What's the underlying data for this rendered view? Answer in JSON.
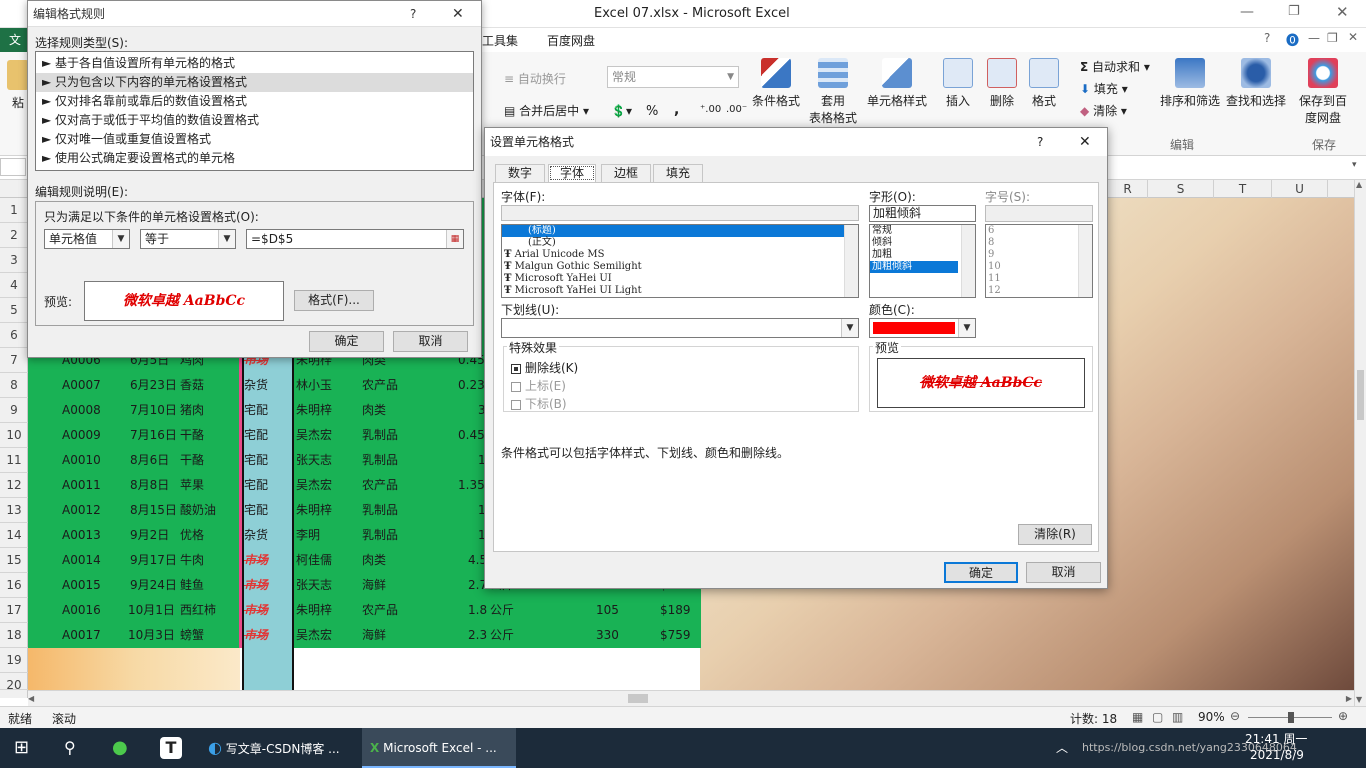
{
  "window_title": "Excel 07.xlsx  -  Microsoft Excel",
  "tabs": {
    "file": "文",
    "tools": "工具集",
    "baidu": "百度网盘"
  },
  "ribbon": {
    "wrap_text": "自动换行",
    "number_format": "常规",
    "merge_center": "合并后居中",
    "conditional_format": "条件格式",
    "table_format_1": "套用",
    "table_format_2": "表格格式",
    "cell_styles": "单元格样式",
    "insert": "插入",
    "delete": "删除",
    "format": "格式",
    "autosum": "自动求和",
    "fill": "填充",
    "clear": "清除",
    "sort_filter": "排序和筛选",
    "find_select": "查找和选择",
    "save_baidu_1": "保存到百",
    "save_baidu_2": "度网盘",
    "group_edit": "编辑",
    "group_save": "保存",
    "paste": "粘",
    "percent": "%",
    "comma": ","
  },
  "columns": [
    "R",
    "S",
    "T",
    "U"
  ],
  "rows": [
    {
      "n": "1"
    },
    {
      "n": "2"
    },
    {
      "n": "3"
    },
    {
      "n": "4"
    },
    {
      "n": "5"
    },
    {
      "n": "6"
    },
    {
      "n": "7",
      "id": "A0006",
      "date": "6月5日",
      "item": "鸡肉",
      "type": "市场",
      "name": "朱明梓",
      "cat": "肉类",
      "qty": "0.45",
      "unit": "",
      "num": "",
      "price": ""
    },
    {
      "n": "8",
      "id": "A0007",
      "date": "6月23日",
      "item": "香菇",
      "type": "杂货",
      "name": "林小玉",
      "cat": "农产品",
      "qty": "0.23",
      "unit": "",
      "num": "",
      "price": ""
    },
    {
      "n": "9",
      "id": "A0008",
      "date": "7月10日",
      "item": "猪肉",
      "type": "宅配",
      "name": "朱明梓",
      "cat": "肉类",
      "qty": "3",
      "unit": "",
      "num": "",
      "price": ""
    },
    {
      "n": "10",
      "id": "A0009",
      "date": "7月16日",
      "item": "干酪",
      "type": "宅配",
      "name": "吴杰宏",
      "cat": "乳制品",
      "qty": "0.45",
      "unit": "",
      "num": "",
      "price": ""
    },
    {
      "n": "11",
      "id": "A0010",
      "date": "8月6日",
      "item": "干酪",
      "type": "宅配",
      "name": "张天志",
      "cat": "乳制品",
      "qty": "1",
      "unit": "",
      "num": "",
      "price": ""
    },
    {
      "n": "12",
      "id": "A0011",
      "date": "8月8日",
      "item": "苹果",
      "type": "宅配",
      "name": "吴杰宏",
      "cat": "农产品",
      "qty": "1.35",
      "unit": "",
      "num": "",
      "price": ""
    },
    {
      "n": "13",
      "id": "A0012",
      "date": "8月15日",
      "item": "酸奶油",
      "type": "宅配",
      "name": "朱明梓",
      "cat": "乳制品",
      "qty": "1",
      "unit": "",
      "num": "",
      "price": ""
    },
    {
      "n": "14",
      "id": "A0013",
      "date": "9月2日",
      "item": "优格",
      "type": "杂货",
      "name": "李明",
      "cat": "乳制品",
      "qty": "1",
      "unit": "",
      "num": "",
      "price": ""
    },
    {
      "n": "15",
      "id": "A0014",
      "date": "9月17日",
      "item": "牛肉",
      "type": "市场",
      "name": "柯佳儒",
      "cat": "肉类",
      "qty": "4.5",
      "unit": "",
      "num": "",
      "price": ""
    },
    {
      "n": "16",
      "id": "A0015",
      "date": "9月24日",
      "item": "鲑鱼",
      "type": "市场",
      "name": "张天志",
      "cat": "海鲜",
      "qty": "2.7",
      "unit": "公斤",
      "num": "270",
      "price": "$729"
    },
    {
      "n": "17",
      "id": "A0016",
      "date": "10月1日",
      "item": "西红柿",
      "type": "市场",
      "name": "朱明梓",
      "cat": "农产品",
      "qty": "1.8",
      "unit": "公斤",
      "num": "105",
      "price": "$189"
    },
    {
      "n": "18",
      "id": "A0017",
      "date": "10月3日",
      "item": "螃蟹",
      "type": "市场",
      "name": "吴杰宏",
      "cat": "海鲜",
      "qty": "2.3",
      "unit": "公斤",
      "num": "330",
      "price": "$759"
    },
    {
      "n": "19"
    },
    {
      "n": "20"
    }
  ],
  "status": {
    "ready": "就绪",
    "scroll": "滚动",
    "count": "计数: 18",
    "zoom": "90%"
  },
  "taskbar": {
    "csdn": "写文章-CSDN博客 ...",
    "excel": "Microsoft Excel - ...",
    "time": "21:41 周一",
    "date": "2021/8/9",
    "url": "https://blog.csdn.net/yang2330648064"
  },
  "dlg1": {
    "title": "编辑格式规则",
    "help": "?",
    "close": "✕",
    "rule_type_label": "选择规则类型(S):",
    "rule_types": [
      "基于各自值设置所有单元格的格式",
      "只为包含以下内容的单元格设置格式",
      "仅对排名靠前或靠后的数值设置格式",
      "仅对高于或低于平均值的数值设置格式",
      "仅对唯一值或重复值设置格式",
      "使用公式确定要设置格式的单元格"
    ],
    "desc_label": "编辑规则说明(E):",
    "only_label": "只为满足以下条件的单元格设置格式(O):",
    "combo1": "单元格值",
    "combo2": "等于",
    "value": "=$D$5",
    "preview_label": "预览:",
    "preview_text": "微软卓越   AaBbCc",
    "format_btn": "格式(F)...",
    "ok": "确定",
    "cancel": "取消"
  },
  "dlg2": {
    "title": "设置单元格格式",
    "help": "?",
    "close": "✕",
    "tabs": [
      "数字",
      "字体",
      "边框",
      "填充"
    ],
    "font_label": "字体(F):",
    "fonts": [
      "(标题)",
      "(正文)",
      "Arial Unicode MS",
      "Malgun Gothic Semilight",
      "Microsoft YaHei UI",
      "Microsoft YaHei UI Light"
    ],
    "style_label": "字形(O):",
    "style_value": "加粗倾斜",
    "styles": [
      "常规",
      "倾斜",
      "加粗",
      "加粗倾斜"
    ],
    "size_label": "字号(S):",
    "sizes": [
      "6",
      "8",
      "9",
      "10",
      "11",
      "12"
    ],
    "underline_label": "下划线(U):",
    "color_label": "颜色(C):",
    "color_value": "#ff0000",
    "effects_label": "特殊效果",
    "strike": "删除线(K)",
    "superscript": "上标(E)",
    "subscript": "下标(B)",
    "preview_label": "预览",
    "preview_text": "微软卓越   AaBbCc",
    "note": "条件格式可以包括字体样式、下划线、颜色和删除线。",
    "clear_btn": "清除(R)",
    "ok": "确定",
    "cancel": "取消"
  }
}
